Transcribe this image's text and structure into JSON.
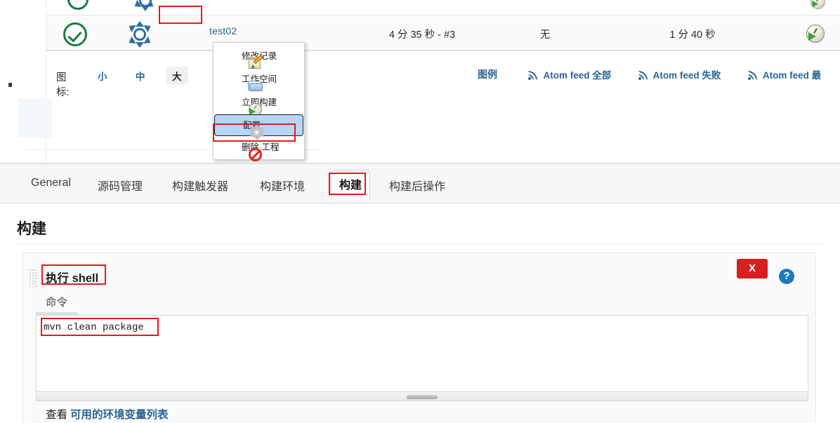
{
  "job_list": {
    "row": {
      "status_icon": "green-check-success-icon",
      "weather_icon": "sun-weather-icon",
      "job_name": "test02",
      "last_success": "4 分 35 秒 - #3",
      "last_failure": "无",
      "duration": "1 分 40 秒",
      "build_icon": "schedule-build-icon"
    },
    "icon_size": {
      "label": "图标:",
      "options": [
        {
          "label": "小",
          "selected": false
        },
        {
          "label": "中",
          "selected": false
        },
        {
          "label": "大",
          "selected": true
        }
      ]
    },
    "feeds": {
      "legend_label": "图例",
      "links": [
        {
          "label": "Atom feed 全部",
          "icon": "rss-icon"
        },
        {
          "label": "Atom feed 失败",
          "icon": "rss-icon"
        },
        {
          "label": "Atom feed 最",
          "icon": "rss-icon"
        }
      ]
    }
  },
  "context_menu": {
    "items": [
      {
        "label": "修改记录",
        "icon": "notepad-pencil-icon",
        "active": false
      },
      {
        "label": "工作空间",
        "icon": "folder-icon",
        "active": false
      },
      {
        "label": "立即构建",
        "icon": "clock-play-icon",
        "active": false
      },
      {
        "label": "配置",
        "icon": "gear-icon",
        "active": true
      },
      {
        "label": "删除 工程",
        "icon": "prohibition-icon",
        "active": false
      }
    ]
  },
  "config": {
    "tabs": [
      {
        "label": "General",
        "active": false
      },
      {
        "label": "源码管理",
        "active": false
      },
      {
        "label": "构建触发器",
        "active": false
      },
      {
        "label": "构建环境",
        "active": false
      },
      {
        "label": "构建",
        "active": true
      },
      {
        "label": "构建后操作",
        "active": false
      }
    ],
    "section_title": "构建",
    "step": {
      "title": "执行 shell",
      "field_label": "命令",
      "command_value": "mvn clean package",
      "remove_label": "X",
      "help_label": "?"
    },
    "env_hint": {
      "prefix": "查看",
      "link": "可用的环境变量列表"
    }
  },
  "colors": {
    "highlight_red": "#e8191b",
    "link_blue": "#2a6496",
    "success_green": "#1c7c40",
    "menu_select_blue": "#b5d6f4",
    "delete_red": "#d61f22",
    "help_blue": "#1b7bbd"
  }
}
